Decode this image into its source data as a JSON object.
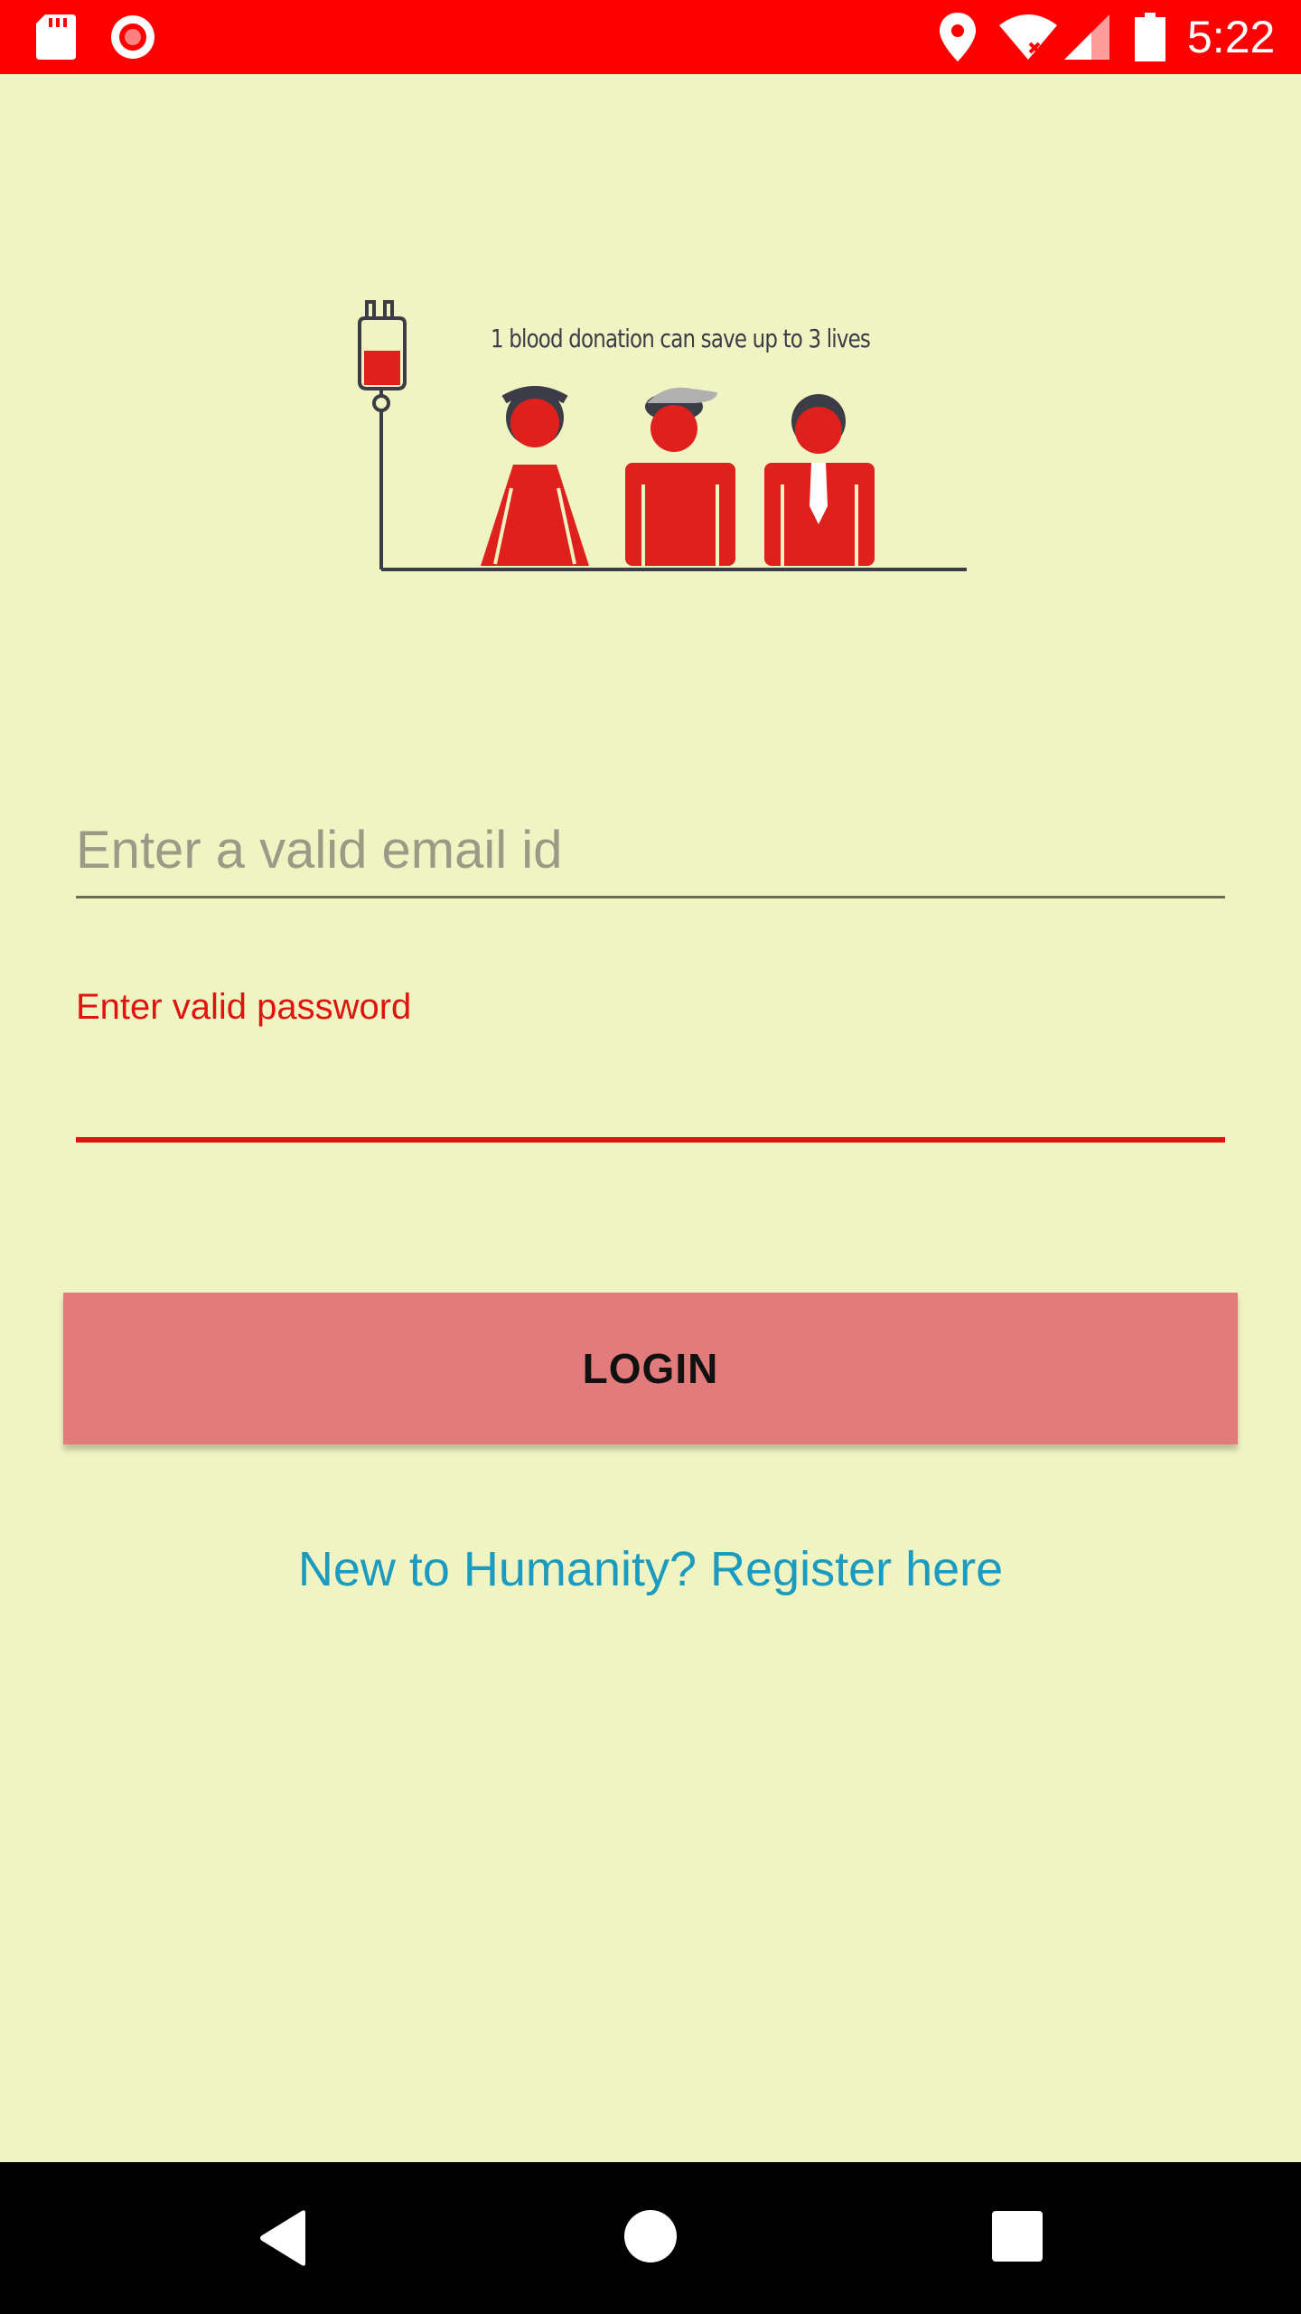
{
  "status_bar": {
    "time": "5:22",
    "background": "#ff0000",
    "icons": [
      "sd-card-icon",
      "record-icon",
      "location-icon",
      "wifi-icon",
      "cell-signal-icon",
      "battery-icon"
    ]
  },
  "illustration": {
    "caption": "1 blood donation can save up to 3 lives",
    "icon": "blood-donation-illustration"
  },
  "form": {
    "email_placeholder": "Enter a valid email id",
    "email_value": "",
    "password_error": "Enter valid password",
    "password_value": "",
    "error_color": "#e0140f"
  },
  "actions": {
    "login_label": "LOGIN",
    "login_color": "#e27b7b",
    "register_text": "New to Humanity? Register here",
    "register_color": "#1a9bbf"
  },
  "nav_bar": {
    "icons": [
      "back-icon",
      "home-icon",
      "recent-apps-icon"
    ]
  },
  "theme": {
    "background": "#f0f4c3"
  }
}
